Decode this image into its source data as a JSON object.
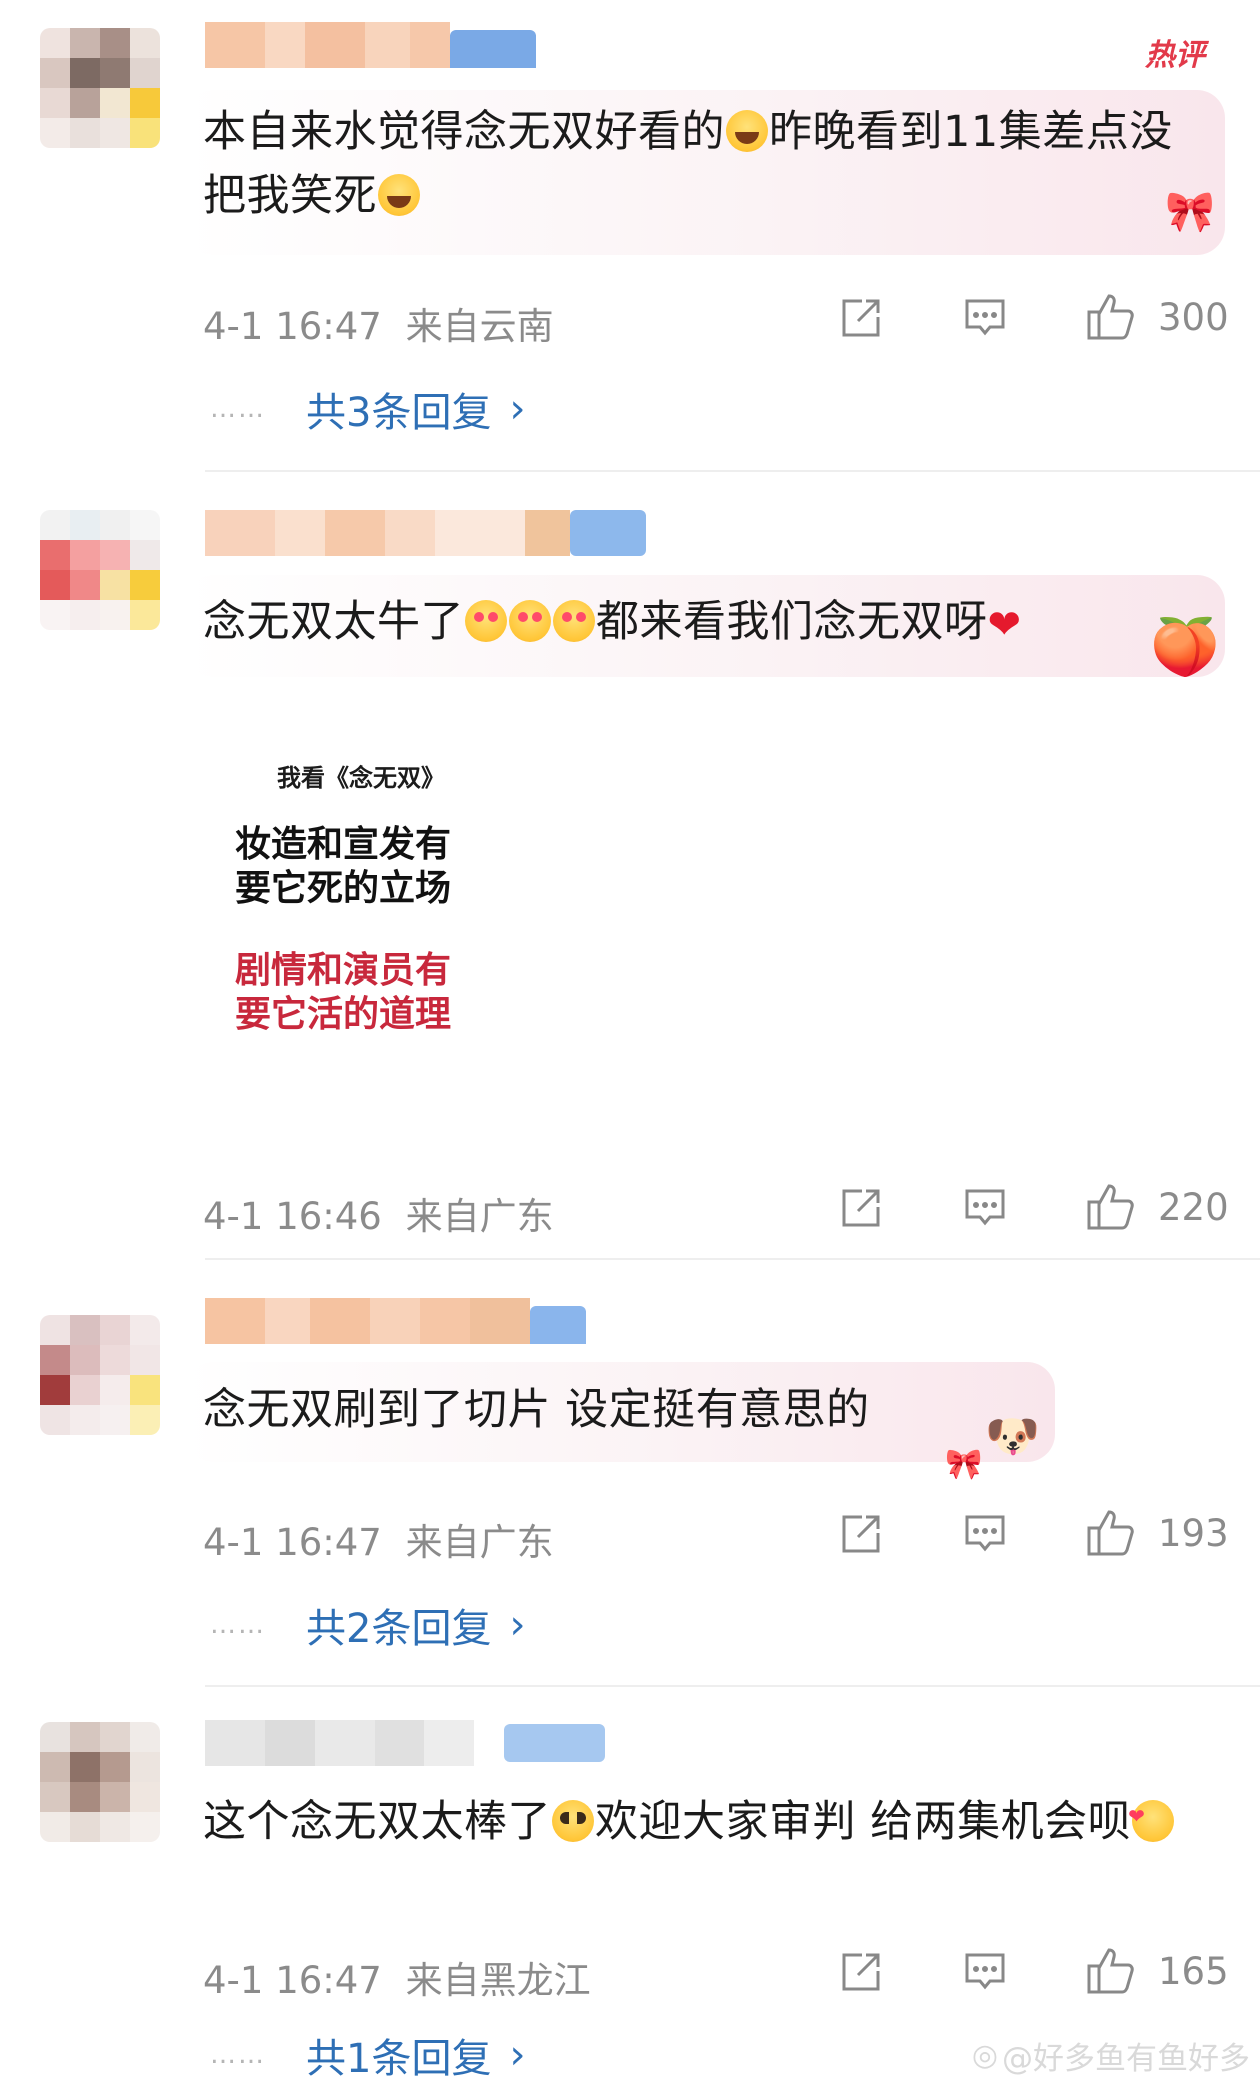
{
  "hot_label": "热评",
  "comments": [
    {
      "text_a": "本自来水觉得念无双好看的",
      "emoji_1": "laugh-emoji",
      "text_b": "昨晚看到11集差点没把我笑死",
      "emoji_2": "laugh-emoji",
      "time": "4-1 16:47",
      "location": "来自云南",
      "likes": "300",
      "replies": "共3条回复"
    },
    {
      "text_a": "念无双太牛了",
      "emojis": [
        "love-eyes-emoji",
        "love-eyes-emoji",
        "love-eyes-emoji"
      ],
      "text_b": "都来看我们念无双呀",
      "heart": "❤",
      "image": {
        "header": "我看《念无双》",
        "line1a": "妆造和宣发有",
        "line1b": "要它死的立场",
        "line2a": "剧情和演员有",
        "line2b": "要它活的道理"
      },
      "time": "4-1 16:46",
      "location": "来自广东",
      "likes": "220"
    },
    {
      "text": "念无双刷到了切片 设定挺有意思的",
      "time": "4-1 16:47",
      "location": "来自广东",
      "likes": "193",
      "replies": "共2条回复"
    },
    {
      "text_a": "这个念无双太棒了",
      "emoji_1": "pleading-emoji",
      "text_b": "欢迎大家审判 给两集机会呗",
      "emoji_2": "kiss-heart-emoji",
      "time": "4-1 16:47",
      "location": "来自黑龙江",
      "likes": "165",
      "replies": "共1条回复"
    }
  ],
  "reply_dots": "……",
  "watermark": "@好多鱼有鱼好多",
  "colors": {
    "link": "#2e6fb5",
    "meta": "#8b8b8b",
    "hot": "#e23a4a",
    "red_text": "#c8283c"
  }
}
